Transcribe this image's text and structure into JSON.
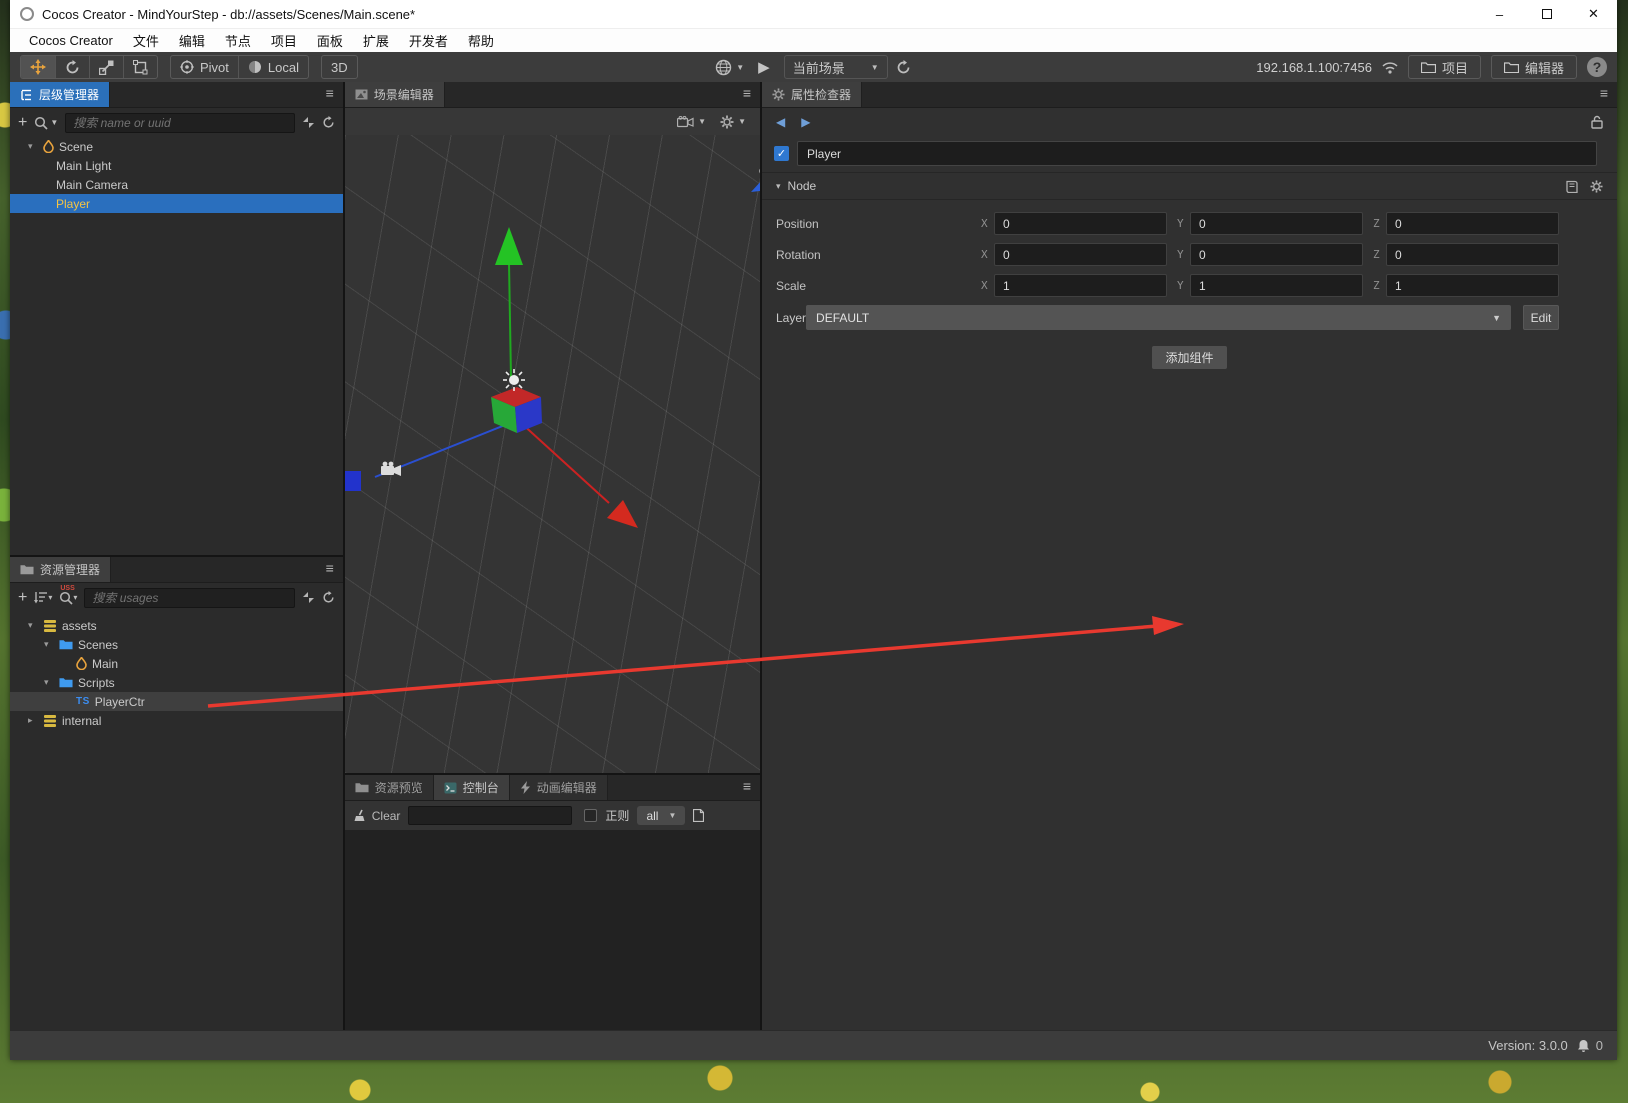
{
  "window": {
    "title": "Cocos Creator - MindYourStep - db://assets/Scenes/Main.scene*",
    "menus": [
      "Cocos Creator",
      "文件",
      "编辑",
      "节点",
      "项目",
      "面板",
      "扩展",
      "开发者",
      "帮助"
    ]
  },
  "toolbar": {
    "pivot_label": "Pivot",
    "local_label": "Local",
    "mode_3d_label": "3D",
    "scene_select_label": "当前场景",
    "device_address": "192.168.1.100:7456",
    "project_label": "项目",
    "editor_label": "编辑器"
  },
  "hierarchy": {
    "tab_label": "层级管理器",
    "search_placeholder": "搜索 name or uuid",
    "nodes": [
      {
        "label": "Scene"
      },
      {
        "label": "Main Light"
      },
      {
        "label": "Main Camera"
      },
      {
        "label": "Player"
      }
    ]
  },
  "assets": {
    "tab_label": "资源管理器",
    "search_placeholder": "搜索 usages",
    "items": [
      {
        "label": "assets"
      },
      {
        "label": "Scenes"
      },
      {
        "label": "Main"
      },
      {
        "label": "Scripts"
      },
      {
        "label": "PlayerCtr"
      },
      {
        "label": "internal"
      }
    ]
  },
  "scene": {
    "tab_label": "场景编辑器"
  },
  "console": {
    "tabs": [
      {
        "label": "资源预览"
      },
      {
        "label": "控制台"
      },
      {
        "label": "动画编辑器"
      }
    ],
    "clear_label": "Clear",
    "filter_value": "",
    "regex_label": "正则",
    "level_value": "all"
  },
  "inspector": {
    "tab_label": "属性检查器",
    "node_name": "Player",
    "section_label": "Node",
    "axis": [
      "X",
      "Y",
      "Z"
    ],
    "rows": [
      {
        "label": "Position",
        "x": "0",
        "y": "0",
        "z": "0"
      },
      {
        "label": "Rotation",
        "x": "0",
        "y": "0",
        "z": "0"
      },
      {
        "label": "Scale",
        "x": "1",
        "y": "1",
        "z": "1"
      }
    ],
    "layer_label": "Layer",
    "layer_value": "DEFAULT",
    "edit_label": "Edit",
    "add_component_label": "添加组件"
  },
  "statusbar": {
    "version": "Version: 3.0.0",
    "notification_count": "0"
  },
  "icons": {
    "hamburger": "≡",
    "plus": "+",
    "help": "?",
    "play": "▶",
    "dropdown": "▼",
    "caret_down": "▾",
    "caret_right": "▸",
    "minimize": "–",
    "close": "✕",
    "check": "✓",
    "ts_badge": "TS",
    "back": "◀",
    "forward": "▶"
  },
  "colors": {
    "selection_blue": "#2a6fbe",
    "active_tool_orange": "#e8a33d",
    "annotation_red": "#e8392f",
    "ts_blue": "#3c8df0",
    "folder_blue": "#3f9bf0",
    "scene_orange": "#e8a33d",
    "selected_node_text": "#f5c443"
  }
}
